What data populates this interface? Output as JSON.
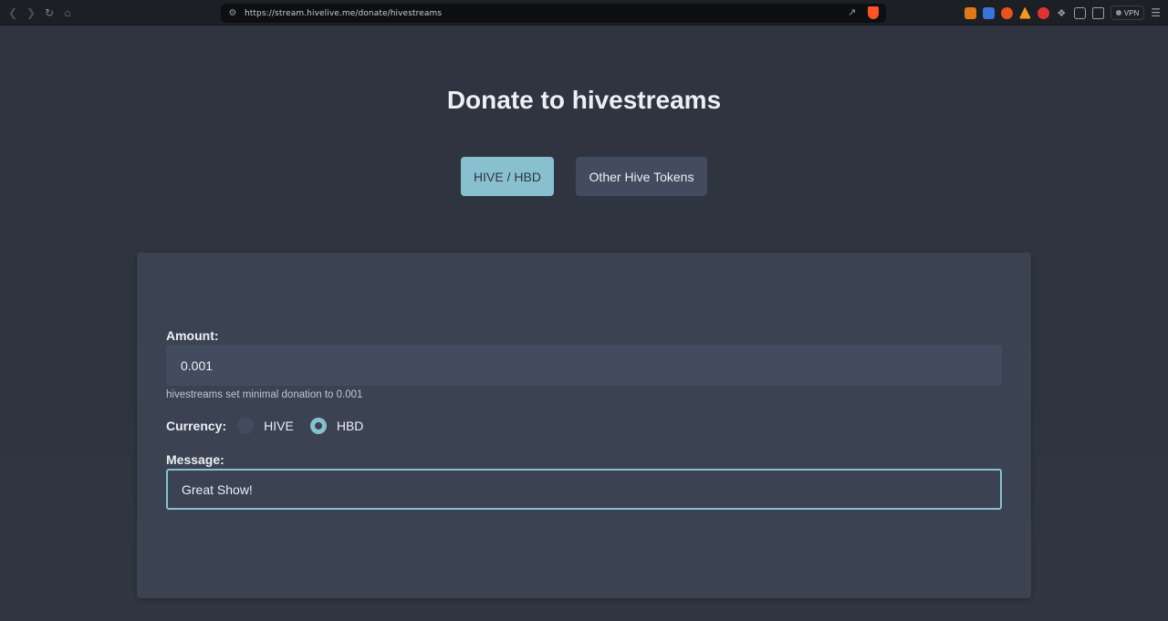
{
  "browser": {
    "url": "https://stream.hivelive.me/donate/hivestreams",
    "vpn_label": "VPN"
  },
  "page": {
    "title": "Donate to hivestreams",
    "tabs": [
      {
        "label": "HIVE / HBD",
        "active": true
      },
      {
        "label": "Other Hive Tokens",
        "active": false
      }
    ]
  },
  "form": {
    "amount_label": "Amount:",
    "amount_value": "0.001",
    "hint": "hivestreams set minimal donation to 0.001",
    "currency_label": "Currency:",
    "currency_options": [
      {
        "label": "HIVE",
        "checked": false
      },
      {
        "label": "HBD",
        "checked": true
      }
    ],
    "message_label": "Message:",
    "message_value": "Great Show!"
  },
  "colors": {
    "background": "#2e3440",
    "card": "#3b4252",
    "accent": "#88c0d0",
    "input": "#434c5e"
  }
}
